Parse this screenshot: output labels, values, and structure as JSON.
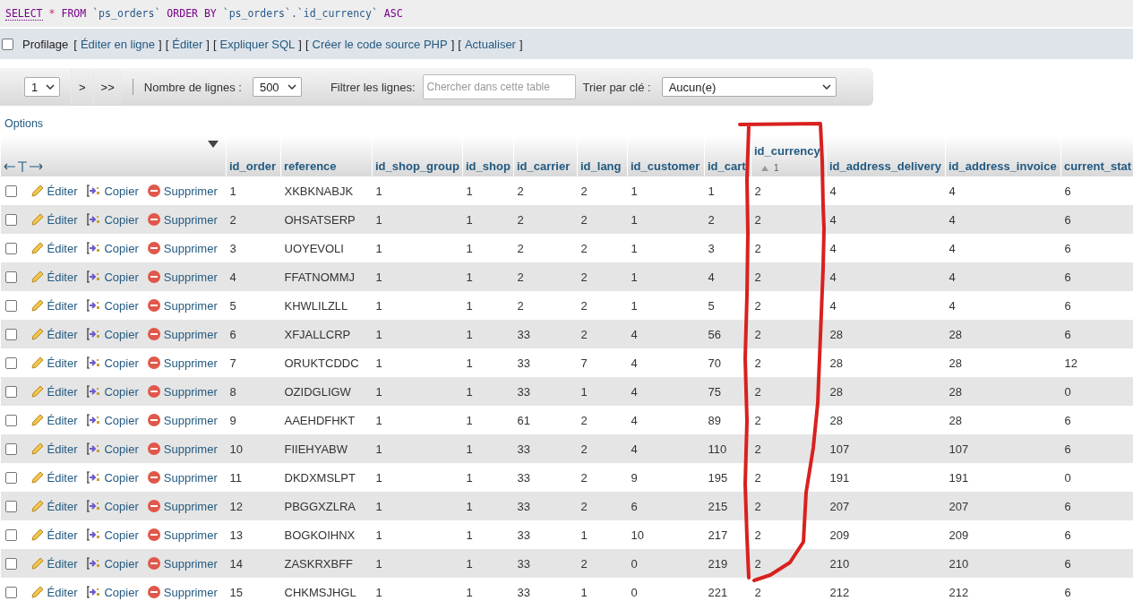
{
  "query": {
    "tokens": [
      {
        "kind": "keyword",
        "text": "SELECT"
      },
      {
        "kind": "operator",
        "text": "*"
      },
      {
        "kind": "keyword",
        "text": "FROM"
      },
      {
        "kind": "identifier",
        "text": "`ps_orders`"
      },
      {
        "kind": "keyword",
        "text": "ORDER BY"
      },
      {
        "kind": "identifier",
        "text": "`ps_orders`.`id_currency`"
      },
      {
        "kind": "keyword",
        "text": "ASC"
      }
    ]
  },
  "actions_bar": {
    "profiling": {
      "label": "Profilage",
      "checked": false
    },
    "parts": [
      {
        "kind": "bracket",
        "text": "["
      },
      {
        "kind": "link",
        "text": "Éditer en ligne"
      },
      {
        "kind": "bracket",
        "text": "]"
      },
      {
        "kind": "bracket",
        "text": "["
      },
      {
        "kind": "link",
        "text": "Éditer"
      },
      {
        "kind": "bracket",
        "text": "]"
      },
      {
        "kind": "bracket",
        "text": "["
      },
      {
        "kind": "link",
        "text": "Expliquer SQL"
      },
      {
        "kind": "bracket",
        "text": "]"
      },
      {
        "kind": "bracket",
        "text": "["
      },
      {
        "kind": "link",
        "text": "Créer le code source PHP"
      },
      {
        "kind": "bracket",
        "text": "]"
      },
      {
        "kind": "bracket",
        "text": "["
      },
      {
        "kind": "link",
        "text": "Actualiser"
      },
      {
        "kind": "bracket",
        "text": "]"
      }
    ]
  },
  "navigation": {
    "page": "1",
    "next": ">",
    "last": ">>",
    "rows_label": "Nombre de lignes :",
    "rows_value": "500",
    "filter_label": "Filtrer les lignes:",
    "filter_placeholder": "Chercher dans cette table",
    "sort_label": "Trier par clé :",
    "sort_value": "Aucun(e)"
  },
  "options_link": "Options",
  "table": {
    "columns": [
      {
        "label": "id_order"
      },
      {
        "label": "reference"
      },
      {
        "label": "id_shop_group"
      },
      {
        "label": "id_shop"
      },
      {
        "label": "id_carrier"
      },
      {
        "label": "id_lang"
      },
      {
        "label": "id_customer"
      },
      {
        "label": "id_cart"
      },
      {
        "label": "id_currency",
        "sort_rank": "1"
      },
      {
        "label": "id_address_delivery"
      },
      {
        "label": "id_address_invoice"
      },
      {
        "label": "current_stat"
      }
    ],
    "rows": [
      {
        "checked": false,
        "actions": [
          "Éditer",
          "Copier",
          "Supprimer"
        ],
        "cells": [
          "1",
          "XKBKNABJK",
          "1",
          "1",
          "2",
          "2",
          "1",
          "1",
          "2",
          "4",
          "4",
          "6"
        ]
      },
      {
        "checked": false,
        "actions": [
          "Éditer",
          "Copier",
          "Supprimer"
        ],
        "cells": [
          "2",
          "OHSATSERP",
          "1",
          "1",
          "2",
          "2",
          "1",
          "2",
          "2",
          "4",
          "4",
          "6"
        ]
      },
      {
        "checked": false,
        "actions": [
          "Éditer",
          "Copier",
          "Supprimer"
        ],
        "cells": [
          "3",
          "UOYEVOLI",
          "1",
          "1",
          "2",
          "2",
          "1",
          "3",
          "2",
          "4",
          "4",
          "6"
        ]
      },
      {
        "checked": false,
        "actions": [
          "Éditer",
          "Copier",
          "Supprimer"
        ],
        "cells": [
          "4",
          "FFATNOMMJ",
          "1",
          "1",
          "2",
          "2",
          "1",
          "4",
          "2",
          "4",
          "4",
          "6"
        ]
      },
      {
        "checked": false,
        "actions": [
          "Éditer",
          "Copier",
          "Supprimer"
        ],
        "cells": [
          "5",
          "KHWLILZLL",
          "1",
          "1",
          "2",
          "2",
          "1",
          "5",
          "2",
          "4",
          "4",
          "6"
        ]
      },
      {
        "checked": false,
        "actions": [
          "Éditer",
          "Copier",
          "Supprimer"
        ],
        "cells": [
          "6",
          "XFJALLCRP",
          "1",
          "1",
          "33",
          "2",
          "4",
          "56",
          "2",
          "28",
          "28",
          "6"
        ]
      },
      {
        "checked": false,
        "actions": [
          "Éditer",
          "Copier",
          "Supprimer"
        ],
        "cells": [
          "7",
          "ORUKTCDDC",
          "1",
          "1",
          "33",
          "7",
          "4",
          "70",
          "2",
          "28",
          "28",
          "12"
        ]
      },
      {
        "checked": false,
        "actions": [
          "Éditer",
          "Copier",
          "Supprimer"
        ],
        "cells": [
          "8",
          "OZIDGLIGW",
          "1",
          "1",
          "33",
          "1",
          "4",
          "75",
          "2",
          "28",
          "28",
          "0"
        ]
      },
      {
        "checked": false,
        "actions": [
          "Éditer",
          "Copier",
          "Supprimer"
        ],
        "cells": [
          "9",
          "AAEHDFHKT",
          "1",
          "1",
          "61",
          "2",
          "4",
          "89",
          "2",
          "28",
          "28",
          "6"
        ]
      },
      {
        "checked": false,
        "actions": [
          "Éditer",
          "Copier",
          "Supprimer"
        ],
        "cells": [
          "10",
          "FIIEHYABW",
          "1",
          "1",
          "33",
          "2",
          "4",
          "110",
          "2",
          "107",
          "107",
          "6"
        ]
      },
      {
        "checked": false,
        "actions": [
          "Éditer",
          "Copier",
          "Supprimer"
        ],
        "cells": [
          "11",
          "DKDXMSLPT",
          "1",
          "1",
          "33",
          "2",
          "9",
          "195",
          "2",
          "191",
          "191",
          "0"
        ]
      },
      {
        "checked": false,
        "actions": [
          "Éditer",
          "Copier",
          "Supprimer"
        ],
        "cells": [
          "12",
          "PBGGXZLRA",
          "1",
          "1",
          "33",
          "2",
          "6",
          "215",
          "2",
          "207",
          "207",
          "6"
        ]
      },
      {
        "checked": false,
        "actions": [
          "Éditer",
          "Copier",
          "Supprimer"
        ],
        "cells": [
          "13",
          "BOGKOIHNX",
          "1",
          "1",
          "33",
          "1",
          "10",
          "217",
          "2",
          "209",
          "209",
          "6"
        ]
      },
      {
        "checked": false,
        "actions": [
          "Éditer",
          "Copier",
          "Supprimer"
        ],
        "cells": [
          "14",
          "ZASKRXBFF",
          "1",
          "1",
          "33",
          "2",
          "0",
          "219",
          "2",
          "210",
          "210",
          "6"
        ]
      },
      {
        "checked": false,
        "actions": [
          "Éditer",
          "Copier",
          "Supprimer"
        ],
        "cells": [
          "15",
          "CHKMSJHGL",
          "1",
          "1",
          "33",
          "1",
          "0",
          "221",
          "2",
          "212",
          "212",
          "6"
        ]
      }
    ]
  }
}
